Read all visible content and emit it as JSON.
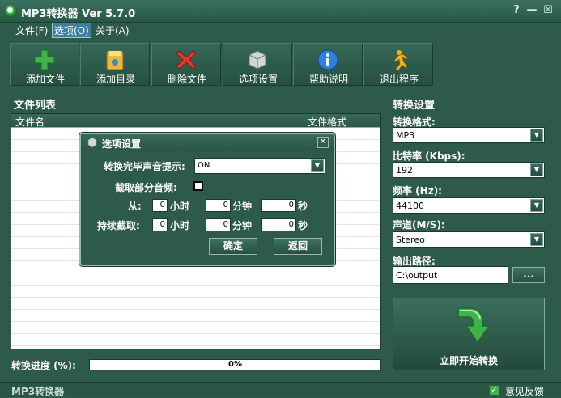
{
  "app": {
    "title": "MP3转换器 Ver 5.7.0"
  },
  "window_buttons": {
    "help": "?",
    "minimize": "—",
    "close": "☒"
  },
  "menu": [
    "文件(F)",
    "选项(O)",
    "关于(A)"
  ],
  "toolbar": [
    {
      "label": "添加文件",
      "icon": "add-file-icon"
    },
    {
      "label": "添加目录",
      "icon": "add-folder-icon"
    },
    {
      "label": "删除文件",
      "icon": "delete-icon"
    },
    {
      "label": "选项设置",
      "icon": "settings-cube-icon"
    },
    {
      "label": "帮助说明",
      "icon": "info-icon"
    },
    {
      "label": "退出程序",
      "icon": "exit-runner-icon"
    }
  ],
  "file_list": {
    "title": "文件列表",
    "columns": [
      "文件名",
      "文件格式"
    ]
  },
  "progress": {
    "label": "转换进度 (%):",
    "value_text": "0%",
    "value": 0
  },
  "convert_settings": {
    "title": "转换设置",
    "format_label": "转换格式:",
    "format_value": "MP3",
    "bitrate_label": "比特率 (Kbps):",
    "bitrate_value": "192",
    "freq_label": "频率 (Hz):",
    "freq_value": "44100",
    "channel_label": "声道(M/S):",
    "channel_value": "Stereo",
    "output_label": "输出路径:",
    "output_value": "C:\\output",
    "browse_label": "...",
    "start_label": "立即开始转换"
  },
  "status": {
    "left": "MP3转换器",
    "right": "意见反馈",
    "check": "✓"
  },
  "dialog": {
    "title": "选项设置",
    "close": "✕",
    "sound_label": "转换完毕声音提示:",
    "sound_value": "ON",
    "clip_label": "截取部分音频:",
    "from_label": "从:",
    "duration_label": "持续截取:",
    "hours_unit": "小时",
    "minutes_unit": "分钟",
    "seconds_unit": "秒",
    "from_hours": "0",
    "from_minutes": "0",
    "from_seconds": "0",
    "dur_hours": "0",
    "dur_minutes": "0",
    "dur_seconds": "0",
    "ok_label": "确定",
    "back_label": "返回"
  },
  "colors": {
    "accent_green": "#3fb24b",
    "background": "#2e5a4a",
    "border_light": "#9ab8ac"
  }
}
